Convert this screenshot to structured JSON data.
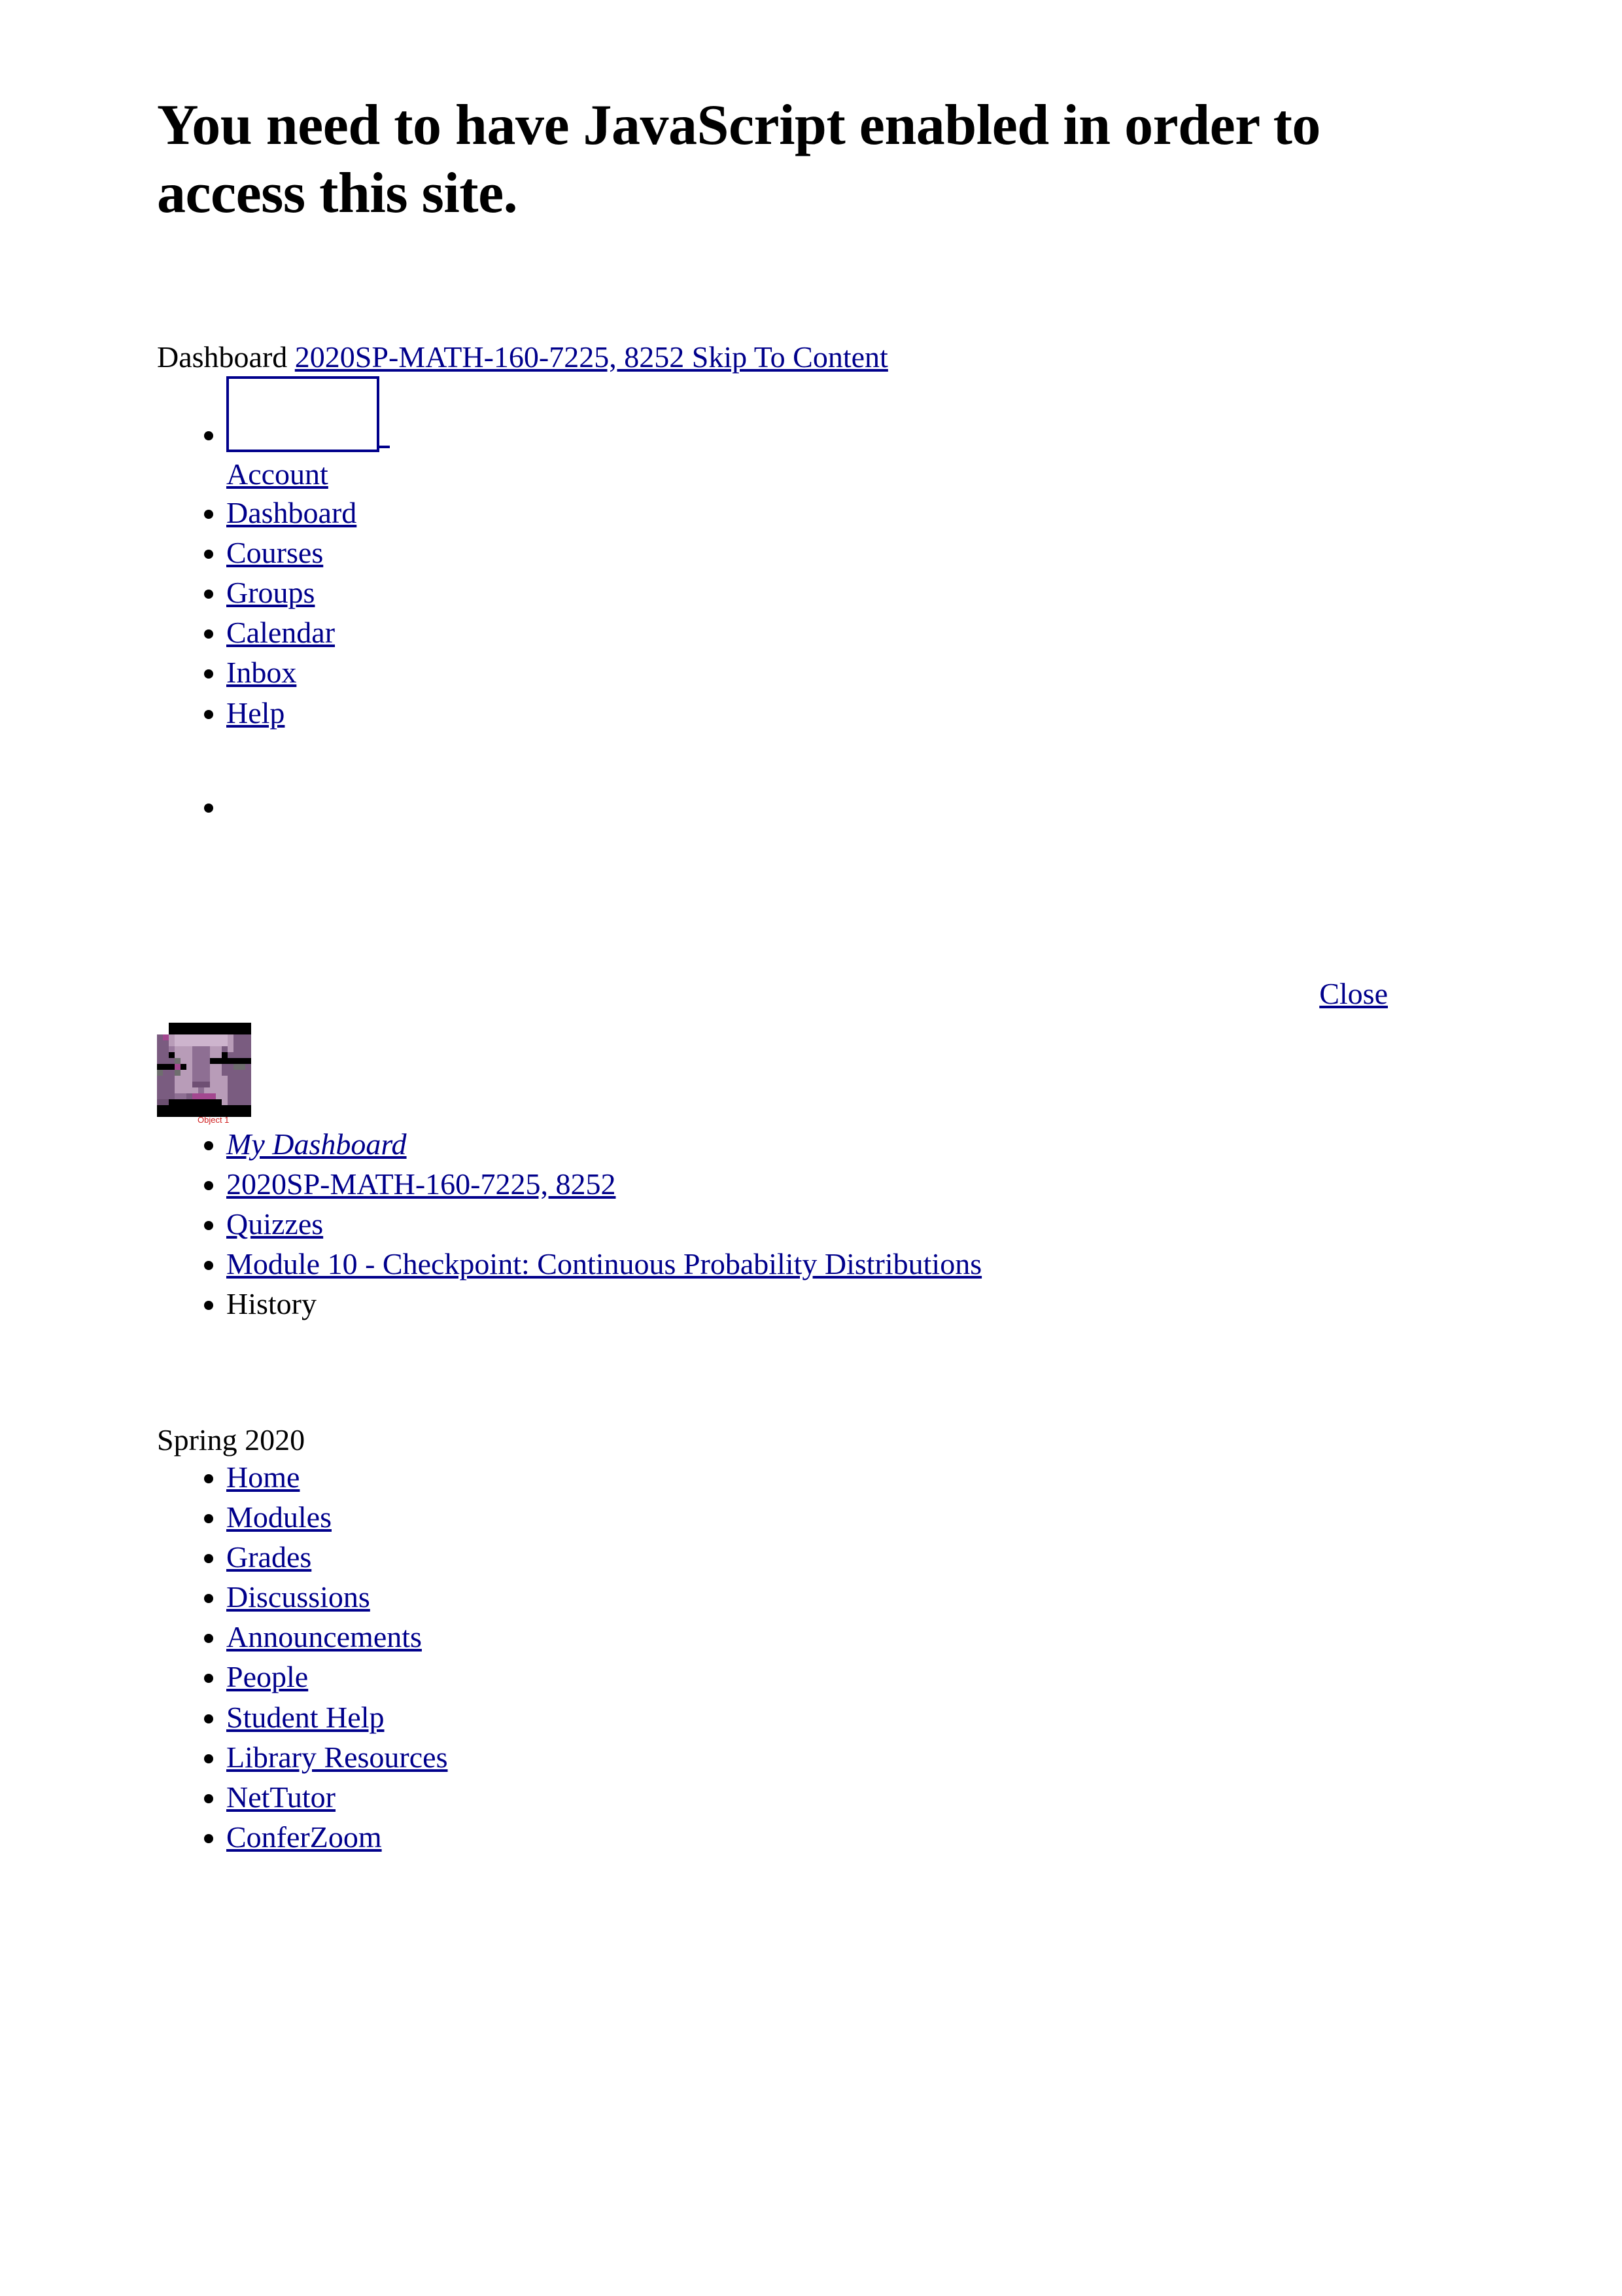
{
  "page": {
    "js_warning": "You need to have JavaScript enabled in order to access this site."
  },
  "breadcrumb_header": {
    "dashboard_text": "Dashboard",
    "course_and_skip_link": "2020SP-MATH-160-7225, 8252 Skip To Content"
  },
  "global_nav": {
    "account": {
      "image_alt": "",
      "label": "Account "
    },
    "items": [
      {
        "label": "Dashboard"
      },
      {
        "label": "Courses "
      },
      {
        "label": "Groups "
      },
      {
        "label": "Calendar "
      },
      {
        "label": "Inbox "
      },
      {
        "label": "Help "
      }
    ]
  },
  "tray": {
    "close_label": "Close"
  },
  "avatar": {
    "caption": "Object 1",
    "colors": {
      "base": "#7a5c80",
      "light": "#b89cb8",
      "lighter": "#cdb4cd",
      "dark": "#5d4463",
      "accent": "#a3478f",
      "black": "#000000"
    }
  },
  "breadcrumbs": [
    {
      "label": "My Dashboard ",
      "link": true,
      "italic": true
    },
    {
      "label": "2020SP-MATH-160-7225, 8252",
      "link": true,
      "italic": false
    },
    {
      "label": "Quizzes",
      "link": true,
      "italic": false
    },
    {
      "label": "Module 10 - Checkpoint: Continuous Probability Distributions",
      "link": true,
      "italic": false
    },
    {
      "label": "History",
      "link": false,
      "italic": false
    }
  ],
  "term": {
    "label": "Spring 2020"
  },
  "course_nav": [
    {
      "label": "Home"
    },
    {
      "label": "Modules"
    },
    {
      "label": "Grades"
    },
    {
      "label": "Discussions"
    },
    {
      "label": "Announcements"
    },
    {
      "label": "People"
    },
    {
      "label": "Student Help"
    },
    {
      "label": "Library Resources"
    },
    {
      "label": "NetTutor"
    },
    {
      "label": "ConferZoom"
    }
  ],
  "colors": {
    "link": "#00008B",
    "text": "#000000",
    "background": "#ffffff",
    "caption": "#d02020"
  }
}
